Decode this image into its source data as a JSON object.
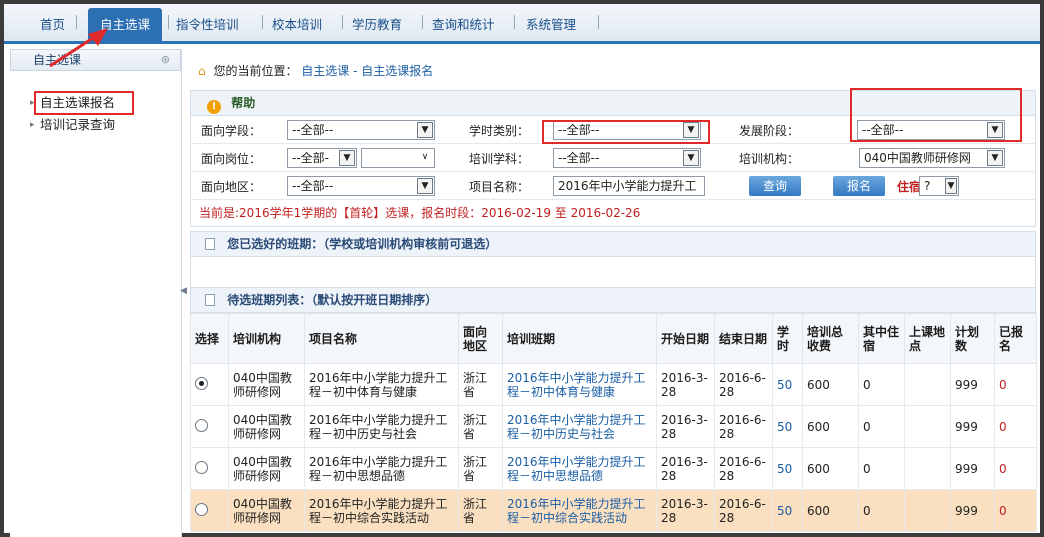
{
  "topnav": {
    "tabs": [
      "首页",
      "自主选课",
      "指令性培训",
      "校本培训",
      "学历教育",
      "查询和统计",
      "系统管理"
    ],
    "active_index": 1
  },
  "sidebar": {
    "title": "自主选课",
    "items": [
      "自主选课报名",
      "培训记录查询"
    ]
  },
  "breadcrumb": {
    "prefix": "您的当前位置：",
    "path": "自主选课 - 自主选课报名"
  },
  "help": {
    "label": "帮助"
  },
  "filters": {
    "school_stage_label": "面向学段：",
    "school_stage_value": "--全部--",
    "hour_type_label": "学时类别：",
    "hour_type_value": "--全部--",
    "dev_stage_label": "发展阶段：",
    "dev_stage_value": "--全部--",
    "post_label": "面向岗位：",
    "post_value": "--全部-",
    "post_sub_value": "",
    "subject_label": "培训学科：",
    "subject_value": "--全部--",
    "org_label": "培训机构：",
    "org_value": "040中国教师研修网",
    "region_label": "面向地区：",
    "region_value": "--全部--",
    "project_label": "项目名称：",
    "project_value": "2016年中小学能力提升工",
    "query_button": "查询",
    "enroll_button": "报名",
    "lodging_label": "住宿",
    "lodging_value": "?"
  },
  "notice": "当前是:2016学年1学期的【首轮】选课，报名时段：2016-02-19 至 2016-02-26",
  "selected_section": "您已选好的班期：（学校或培训机构审核前可退选）",
  "pending_section": "待选班期列表：（默认按开班日期排序）",
  "table": {
    "headers": [
      "选择",
      "培训机构",
      "项目名称",
      "面向地区",
      "培训班期",
      "开始日期",
      "结束日期",
      "学时",
      "培训总收费",
      "其中住宿",
      "上课地点",
      "计划数",
      "已报名"
    ],
    "rows": [
      {
        "selected": true,
        "org": "040中国教师研修网",
        "project": "2016年中小学能力提升工程－初中体育与健康",
        "region": "浙江省",
        "class": "2016年中小学能力提升工程－初中体育与健康",
        "start": "2016-3-28",
        "end": "2016-6-28",
        "hours": "50",
        "fee": "600",
        "lodging": "0",
        "location": "",
        "plan": "999",
        "enrolled": "0",
        "highlight": false
      },
      {
        "selected": false,
        "org": "040中国教师研修网",
        "project": "2016年中小学能力提升工程－初中历史与社会",
        "region": "浙江省",
        "class": "2016年中小学能力提升工程－初中历史与社会",
        "start": "2016-3-28",
        "end": "2016-6-28",
        "hours": "50",
        "fee": "600",
        "lodging": "0",
        "location": "",
        "plan": "999",
        "enrolled": "0",
        "highlight": false
      },
      {
        "selected": false,
        "org": "040中国教师研修网",
        "project": "2016年中小学能力提升工程－初中思想品德",
        "region": "浙江省",
        "class": "2016年中小学能力提升工程－初中思想品德",
        "start": "2016-3-28",
        "end": "2016-6-28",
        "hours": "50",
        "fee": "600",
        "lodging": "0",
        "location": "",
        "plan": "999",
        "enrolled": "0",
        "highlight": false
      },
      {
        "selected": false,
        "org": "040中国教师研修网",
        "project": "2016年中小学能力提升工程－初中综合实践活动",
        "region": "浙江省",
        "class": "2016年中小学能力提升工程－初中综合实践活动",
        "start": "2016-3-28",
        "end": "2016-6-28",
        "hours": "50",
        "fee": "600",
        "lodging": "0",
        "location": "",
        "plan": "999",
        "enrolled": "0",
        "highlight": true
      }
    ]
  }
}
